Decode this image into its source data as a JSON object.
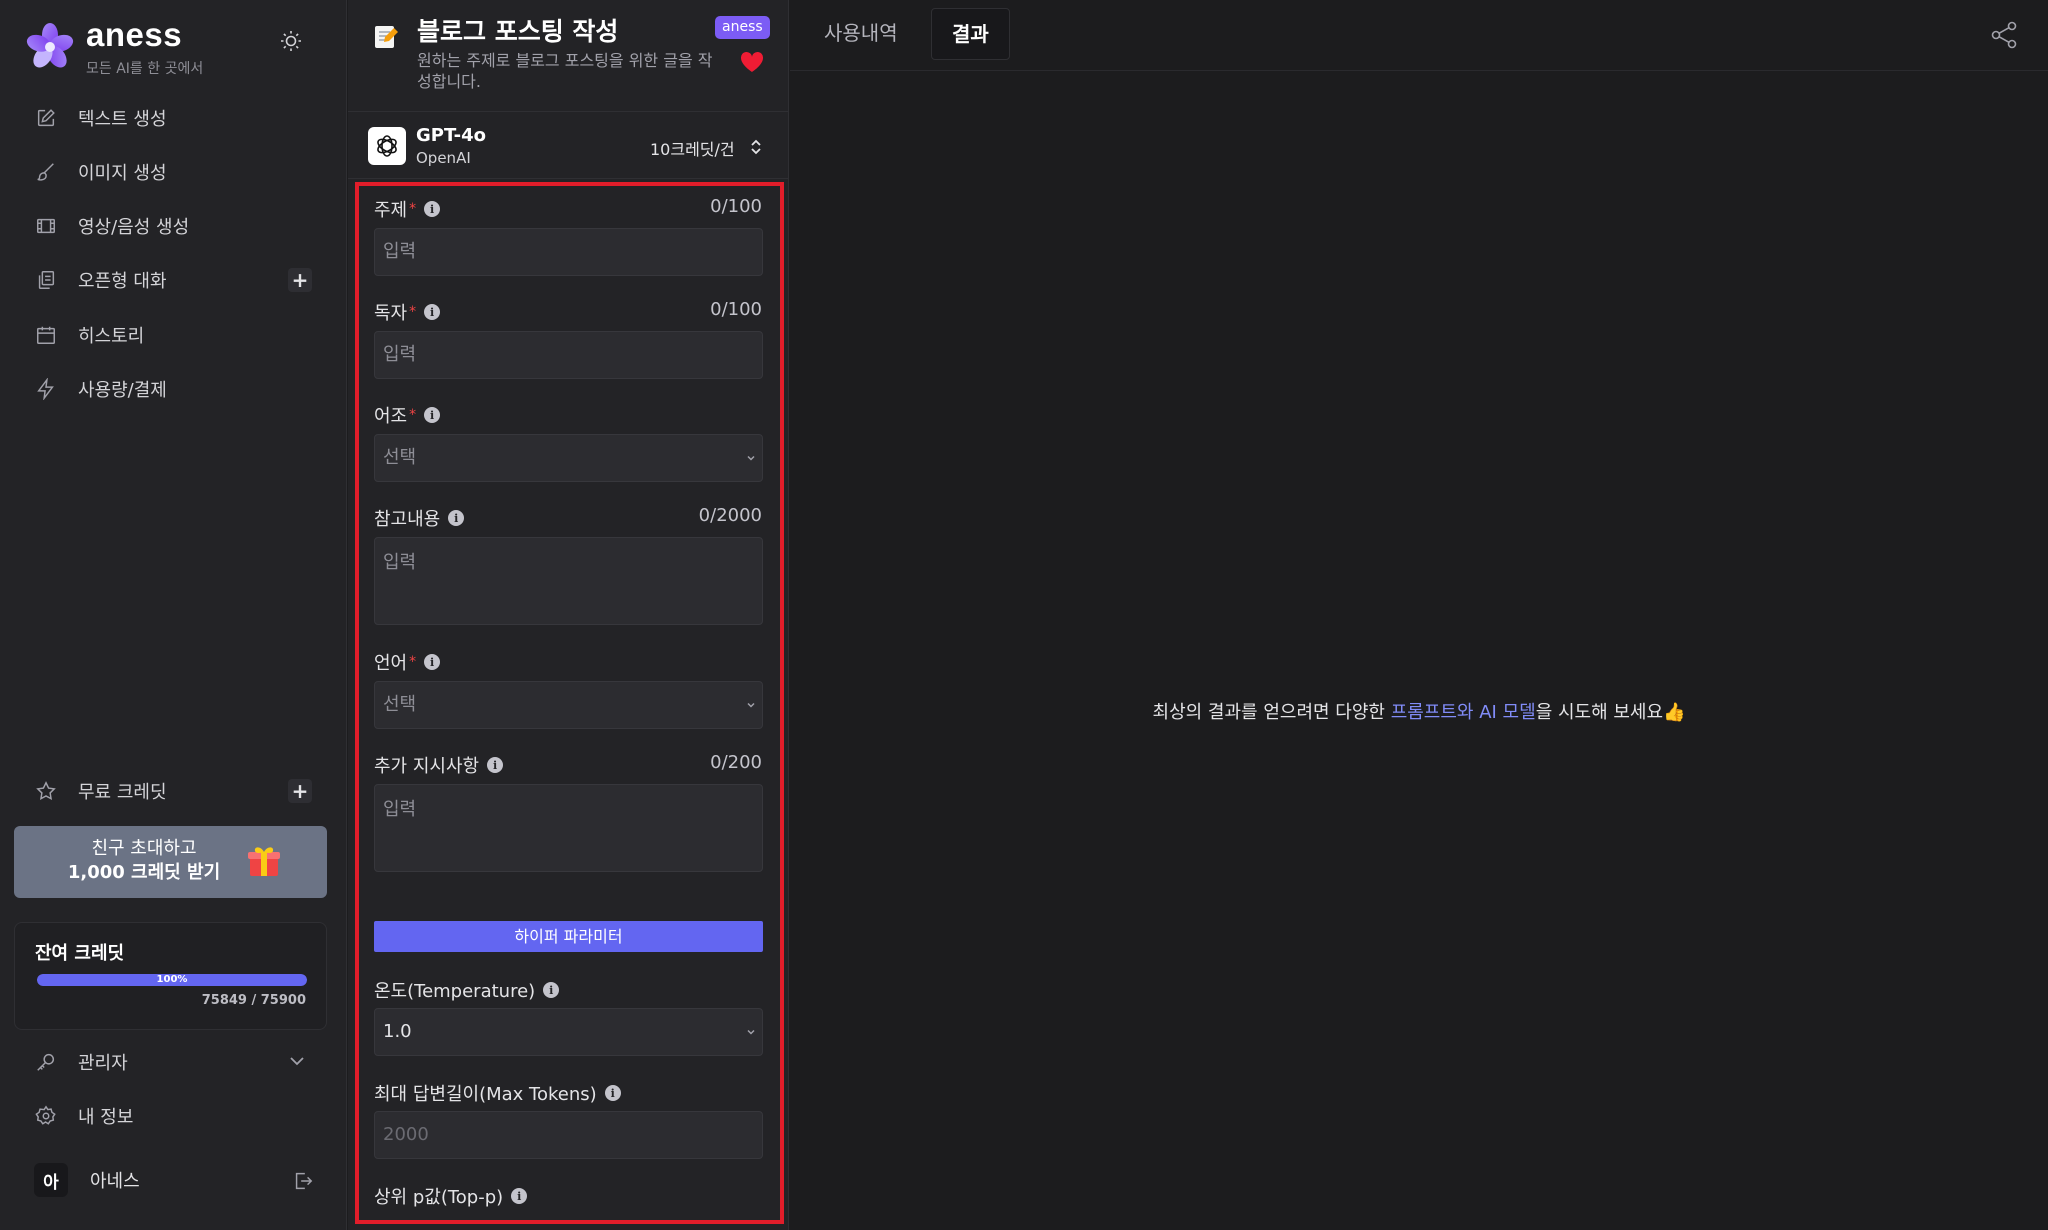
{
  "sidebar": {
    "brand": "aness",
    "tagline": "모든 AI를 한 곳에서",
    "nav": [
      {
        "label": "텍스트 생성",
        "icon": "pencil-square-icon"
      },
      {
        "label": "이미지 생성",
        "icon": "paintbrush-icon"
      },
      {
        "label": "영상/음성 생성",
        "icon": "film-icon"
      },
      {
        "label": "오픈형 대화",
        "icon": "chat-copy-icon"
      },
      {
        "label": "히스토리",
        "icon": "calendar-icon"
      },
      {
        "label": "사용량/결제",
        "icon": "lightning-icon"
      }
    ],
    "free_credit": "무료 크레딧",
    "invite": {
      "line1": "친구 초대하고",
      "line2": "1,000 크레딧 받기"
    },
    "credits": {
      "title": "잔여 크레딧",
      "percent_label": "100%",
      "used_fraction": 1.0,
      "count": "75849 / 75900"
    },
    "admin": "관리자",
    "my_info": "내 정보",
    "user": {
      "avatar": "아",
      "name": "아네스"
    }
  },
  "panel": {
    "title": "블로그 포스팅 작성",
    "description": "원하는 주제로 블로그 포스팅을 위한 글을 작성합니다.",
    "badge": "aness",
    "model": {
      "name": "GPT-4o",
      "vendor": "OpenAI",
      "cost": "10크레딧/건"
    },
    "fields": {
      "topic": {
        "label": "주제",
        "required": "*",
        "counter": "0/100",
        "placeholder": "입력"
      },
      "reader": {
        "label": "독자",
        "required": "*",
        "counter": "0/100",
        "placeholder": "입력"
      },
      "tone": {
        "label": "어조",
        "required": "*",
        "placeholder": "선택"
      },
      "reference": {
        "label": "참고내용",
        "counter": "0/2000",
        "placeholder": "입력"
      },
      "language": {
        "label": "언어",
        "required": "*",
        "placeholder": "선택"
      },
      "extra": {
        "label": "추가 지시사항",
        "counter": "0/200",
        "placeholder": "입력"
      }
    },
    "hyper_button": "하이퍼 파라미터",
    "hyper": {
      "temperature": {
        "label": "온도(Temperature)",
        "value": "1.0"
      },
      "max_tokens": {
        "label": "최대 답변길이(Max Tokens)",
        "value": "2000"
      },
      "top_p": {
        "label": "상위 p값(Top-p)"
      }
    },
    "info_glyph": "i"
  },
  "main": {
    "tabs": [
      "사용내역",
      "결과"
    ],
    "active_tab": "결과",
    "empty_message": {
      "before": "최상의 결과를 얻으려면 다양한 ",
      "highlight": "프롬프트와 AI 모델",
      "after": "을 시도해 보세요👍"
    }
  },
  "colors": {
    "accent": "#6366f1",
    "highlight": "#e11d2a",
    "badge": "#7c5cf5"
  }
}
